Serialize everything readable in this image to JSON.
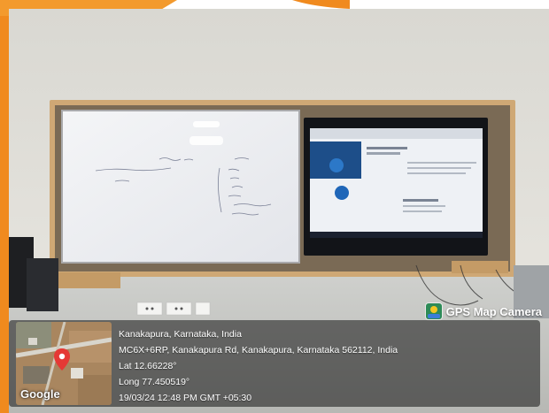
{
  "watermark": {
    "app_name": "GPS Map Camera",
    "location_title": "Kanakapura, Karnataka, India",
    "address": "MC6X+6RP, Kanakapura Rd, Kanakapura, Karnataka 562112, India",
    "latitude": "Lat 12.66228°",
    "longitude": "Long 77.450519°",
    "timestamp": "19/03/24 12:48 PM GMT +05:30",
    "map_brand": "Google",
    "icons": [
      "gps-map-camera-logo-icon",
      "map-pin-icon"
    ]
  },
  "whiteboard": {
    "handwriting": [
      "— — —",
      "— — — — — — — —",
      "— — —"
    ]
  },
  "colors": {
    "frame_wood": "#cfa875",
    "wall": "#dedcd5",
    "orange_accent": "#f08a1e",
    "map_pin": "#e53935"
  }
}
